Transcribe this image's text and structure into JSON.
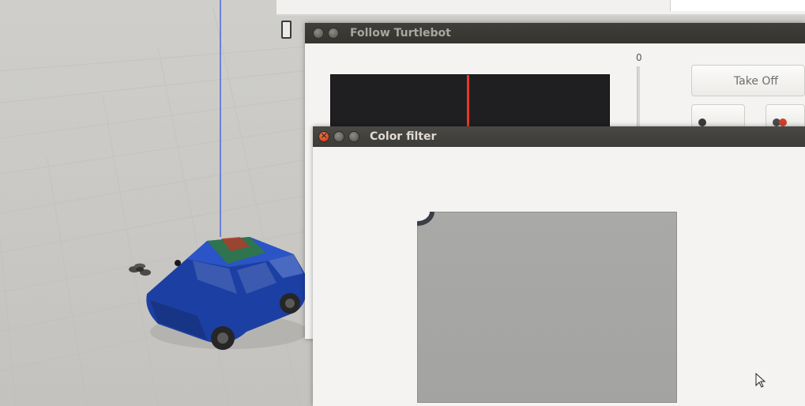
{
  "windows": {
    "follow": {
      "title": "Follow Turtlebot",
      "slider_value": "0",
      "takeoff_label": "Take Off"
    },
    "color_filter": {
      "title": "Color filter"
    }
  },
  "icons": [
    "close-icon",
    "minimize-icon",
    "maximize-icon",
    "mouse-cursor-icon",
    "quadrotor-drone-icon",
    "car-model-icon"
  ],
  "colors": {
    "titlebar": "#3c3b37",
    "close_button": "#e2532a",
    "camera_line": "#e9382a",
    "car_body": "#1c3fa3"
  }
}
